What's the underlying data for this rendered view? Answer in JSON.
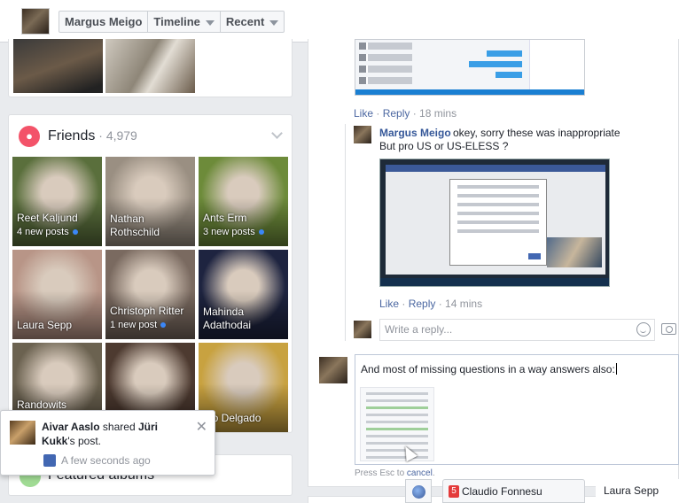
{
  "topbar": {
    "breadcrumbs": [
      "Margus Meigo",
      "Timeline",
      "Recent"
    ]
  },
  "friends": {
    "title": "Friends",
    "count": "4,979",
    "tiles": [
      {
        "name": "Reet Kaljund",
        "sub": "4 new posts",
        "color": "#5a6f3c"
      },
      {
        "name": "Nathan Rothschild",
        "sub": "",
        "color": "#9a8f82"
      },
      {
        "name": "Ants Erm",
        "sub": "3 new posts",
        "color": "#6d8b3a"
      },
      {
        "name": "Laura Sepp",
        "sub": "",
        "color": "#b89587"
      },
      {
        "name": "Christoph Ritter",
        "sub": "1 new post",
        "color": "#7a6a60"
      },
      {
        "name": "Mahinda Adathodai",
        "sub": "",
        "color": "#1e2440"
      },
      {
        "name": "Randowits Sparkly Rambo",
        "sub": "",
        "color": "#6b6250"
      },
      {
        "name": "",
        "sub": "",
        "color": "#4d3a30"
      },
      {
        "name": "dro Delgado",
        "sub": "",
        "color": "#c8a240"
      }
    ]
  },
  "featured": {
    "title": "Featured albums"
  },
  "notification": {
    "actor": "Aivar Aaslo",
    "middle": " shared ",
    "target": "Jüri Kukk",
    "suffix": "'s post.",
    "time": "A few seconds ago"
  },
  "comment1_actions": {
    "like": "Like",
    "reply": "Reply",
    "time": "18 mins"
  },
  "reply": {
    "author": "Margus Meigo",
    "line1": "okey, sorry these was inappropriate",
    "line2": "But pro US or US-ELESS ?",
    "like": "Like",
    "reply": "Reply",
    "time": "14 mins"
  },
  "reply_box": {
    "placeholder": "Write a reply..."
  },
  "compose": {
    "text": "And most of missing questions in a way answers also:",
    "hint_prefix": "Press Esc to ",
    "hint_link": "cancel",
    "hint_suffix": "."
  },
  "chat": {
    "tab1_badge": "5",
    "tab1_name": "Claudio Fonnesu",
    "tab2_name": "Laura Sepp"
  },
  "icons": {
    "friends": "people-icon",
    "smile": "emoji-icon",
    "camera": "camera-icon",
    "globe": "globe-icon",
    "close": "close-icon",
    "chevron": "chevron-down-icon"
  },
  "colors": {
    "link": "#4b67a1",
    "author": "#365899",
    "friends_icon": "#f35369",
    "badge": "#e43b3b"
  }
}
